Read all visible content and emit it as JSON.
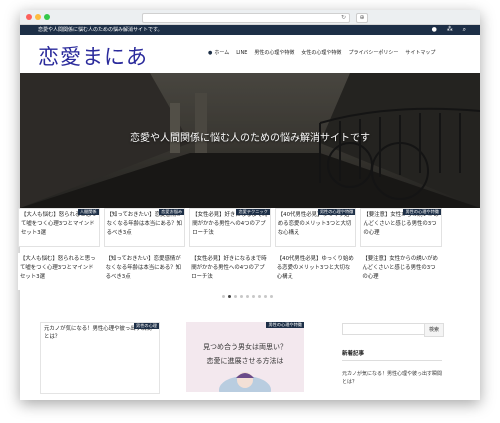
{
  "site": {
    "tagline": "恋愛や人間関係に悩む人のための悩み解消サイトです。",
    "logo": "恋愛まにあ",
    "top_icons": "● ⁂ ⌕"
  },
  "browser": {
    "reload": "↻",
    "newtab": "⊕"
  },
  "nav": {
    "items": [
      {
        "icon": "●",
        "label": "ホーム"
      },
      {
        "icon": "",
        "label": "LINE"
      },
      {
        "icon": "",
        "label": "男性の心理や特徴"
      },
      {
        "icon": "",
        "label": "女性の心理や特徴"
      },
      {
        "icon": "",
        "label": "プライバシーポリシー"
      },
      {
        "icon": "",
        "label": "サイトマップ"
      }
    ]
  },
  "hero": {
    "caption": "恋愛や人間関係に悩む人のための悩み解消サイトです"
  },
  "cards_row1": [
    {
      "title": "【大人も悩む】怒られると思って嘘をつく心理3つとマインドセット3選",
      "badge": "人間関係"
    },
    {
      "title": "【知っておきたい】恋愛感情がなくなる年齢は本当にある？知るべき3点",
      "badge": "恋愛お悩み"
    },
    {
      "title": "【女性必見】好きになるまで時間がかかる男性への4つのアプローチ法",
      "badge": "恋愛テクニック"
    },
    {
      "title": "【40代男性必見】ゆっくり始める恋愛のメリット3つと大切な心構え",
      "badge": "男性の心理や特徴"
    },
    {
      "title": "【要注意】女性からの誘いがめんどくさいと感じる男性の3つの心理",
      "badge": "男性の心理や特徴"
    }
  ],
  "cards_row2": [
    {
      "title": "【大人も悩む】怒られると思って嘘をつく心理3つとマインドセット3選"
    },
    {
      "title": "【知っておきたい】恋愛感情がなくなる年齢は本当にある？知るべき3点"
    },
    {
      "title": "【女性必見】好きになるまで時間がかかる男性への4つのアプローチ法"
    },
    {
      "title": "【40代男性必見】ゆっくり始める恋愛のメリット3つと大切な心構え"
    },
    {
      "title": "【要注意】女性からの誘いがめんどくさいと感じる男性の3つの心理"
    }
  ],
  "slider": {
    "total": 9,
    "active": 1
  },
  "posts": [
    {
      "title": "元カノが気になる！男性心理や彼っ出す瞬間とは？",
      "badge": "男性の心理"
    },
    {
      "title": "",
      "badge": "男性の心理や特徴",
      "thumb_line1": "見つめ合う男女は両思い？",
      "thumb_line2": "恋愛に進展させる方法は"
    }
  ],
  "sidebar": {
    "search_button": "検索",
    "recent_heading": "新着記事",
    "recent_item": "元カノが気になる！男性心理や彼っ出す瞬間とは？"
  }
}
